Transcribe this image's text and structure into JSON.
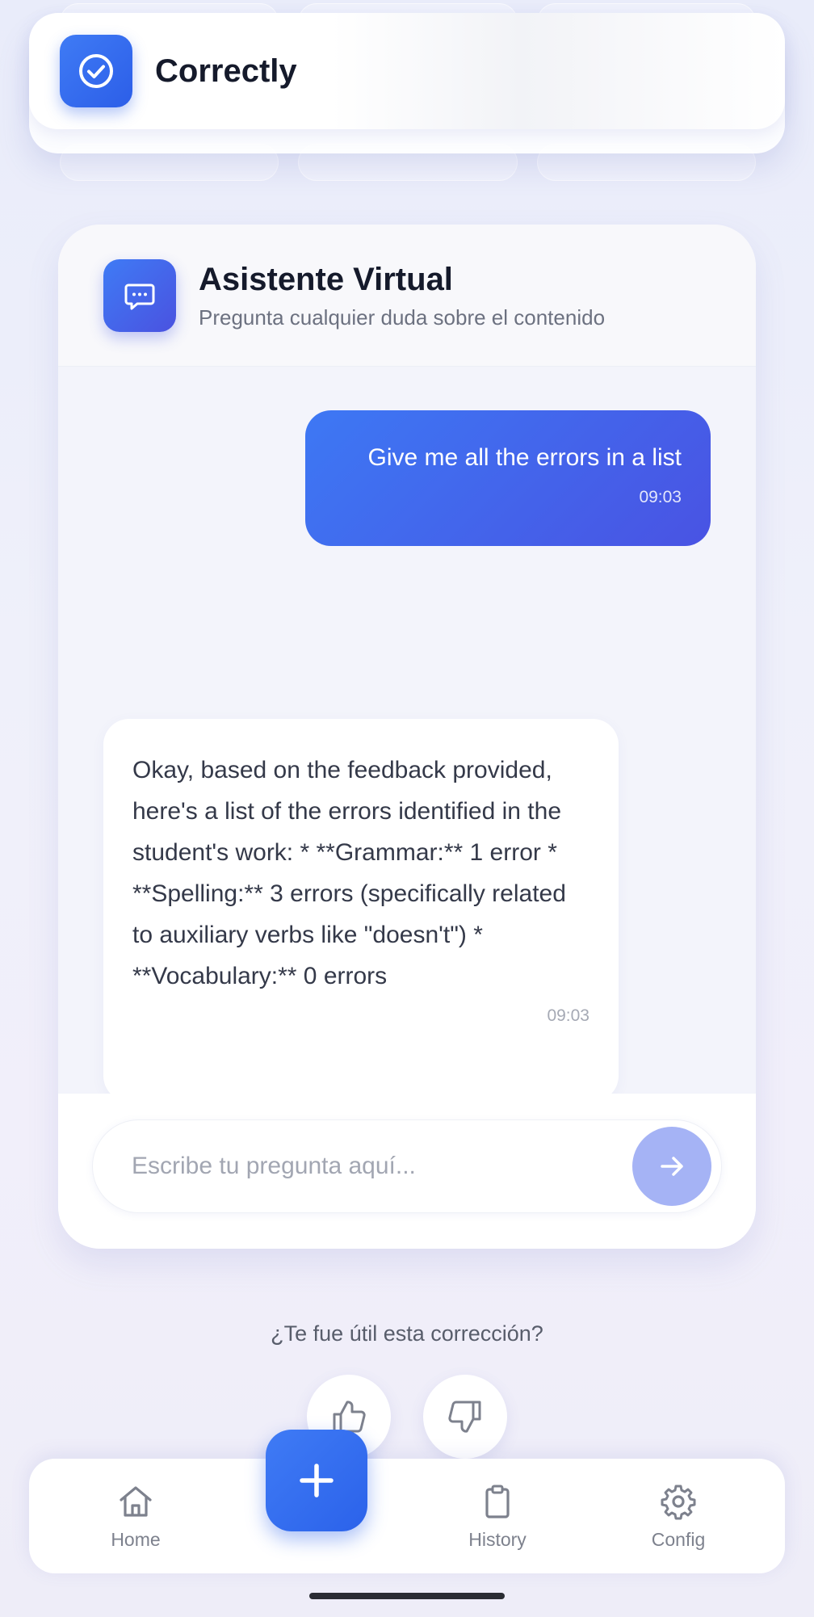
{
  "app": {
    "title": "Correctly"
  },
  "chat": {
    "title": "Asistente Virtual",
    "subtitle": "Pregunta cualquier duda sobre el contenido",
    "messages": [
      {
        "role": "user",
        "text": "Give me all the errors in a list",
        "time": "09:03"
      },
      {
        "role": "assistant",
        "text": "Okay, based on the feedback provided, here's a list of the errors identified in the student's work: * **Grammar:** 1 error * **Spelling:** 3 errors (specifically related to auxiliary verbs like \"doesn't\") * **Vocabulary:** 0 errors",
        "time": "09:03"
      }
    ],
    "input": {
      "placeholder": "Escribe tu pregunta aquí...",
      "value": ""
    }
  },
  "feedback": {
    "question": "¿Te fue útil esta corrección?"
  },
  "nav": {
    "items": [
      {
        "label": "Home",
        "icon": "home-icon"
      },
      {
        "label": "History",
        "icon": "clipboard-icon"
      },
      {
        "label": "Config",
        "icon": "gear-icon"
      }
    ],
    "fab_icon": "plus-icon"
  },
  "colors": {
    "accent": "#2c5ee8",
    "accent_gradient_end": "#4953e3",
    "send_button_disabled": "#a5b3f5"
  }
}
